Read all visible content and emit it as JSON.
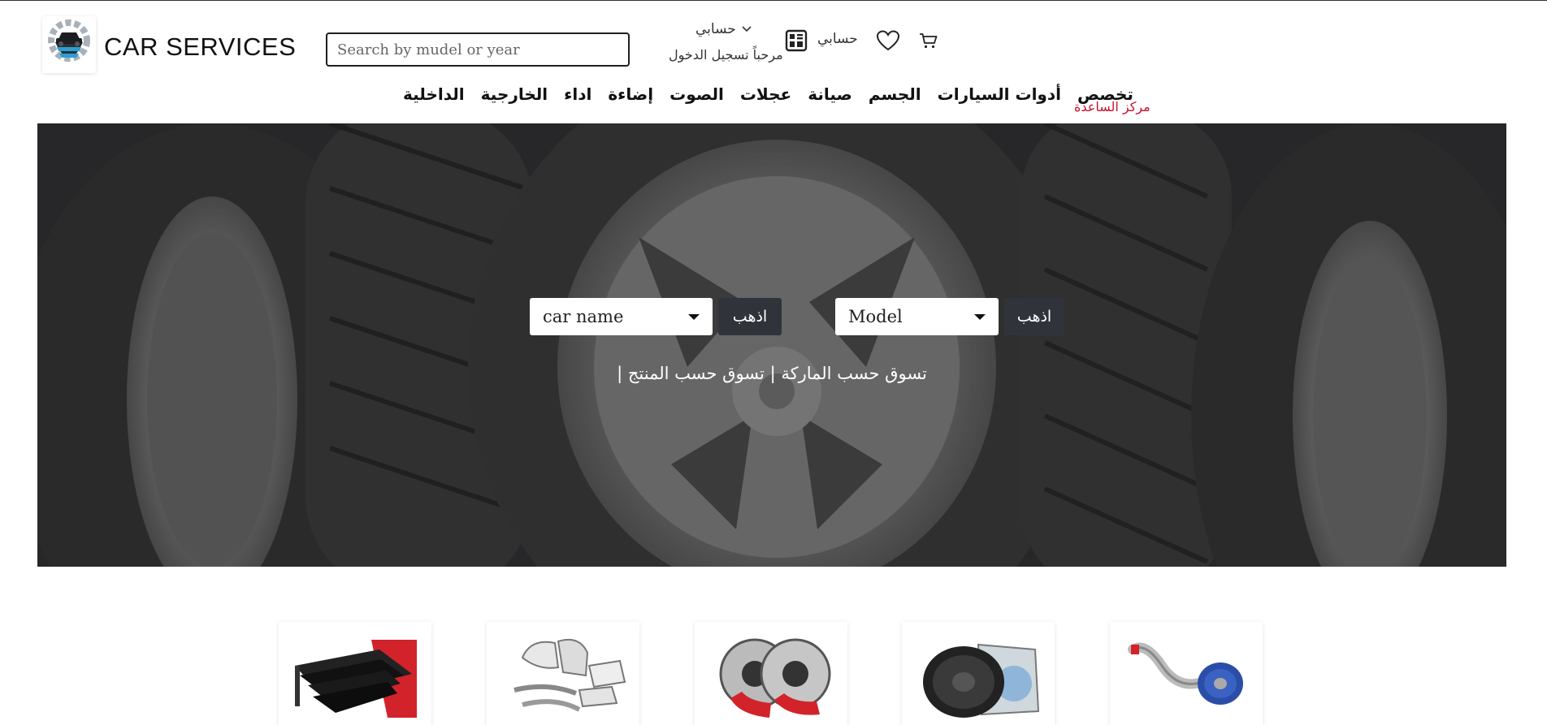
{
  "header": {
    "brand_name": "CAR SERVICES",
    "search_placeholder": "Search by mudel or year",
    "account_dropdown_label": "حسابي",
    "welcome_text": "مرحباً تسجيل الدخول",
    "account_link": "حسابي"
  },
  "nav": {
    "items": [
      "تخصص",
      "أدوات السيارات",
      "الجسم",
      "صيانة",
      "عجلات",
      "الصوت",
      "إضاءة",
      "اداء",
      "الخارجية",
      "الداخلية"
    ],
    "help_center": "مركز الساعدة"
  },
  "hero": {
    "model_select": "Model",
    "model_go": "اذهب",
    "car_name_select": "car name",
    "car_name_go": "اذهب",
    "shop_by_brand": "تسوق حسب الماركة",
    "shop_by_product": "تسوق حسب المنتج",
    "separator": "|"
  },
  "categories": [
    {
      "icon": "truck-bed-drawers-image"
    },
    {
      "icon": "chrome-trim-parts-image"
    },
    {
      "icon": "brake-discs-image"
    },
    {
      "icon": "subwoofer-speaker-image"
    },
    {
      "icon": "air-intake-filter-image"
    }
  ],
  "colors": {
    "help_center": "#c8102e",
    "go_button": "#30343a",
    "hero_bg": "#3a3a3a"
  }
}
